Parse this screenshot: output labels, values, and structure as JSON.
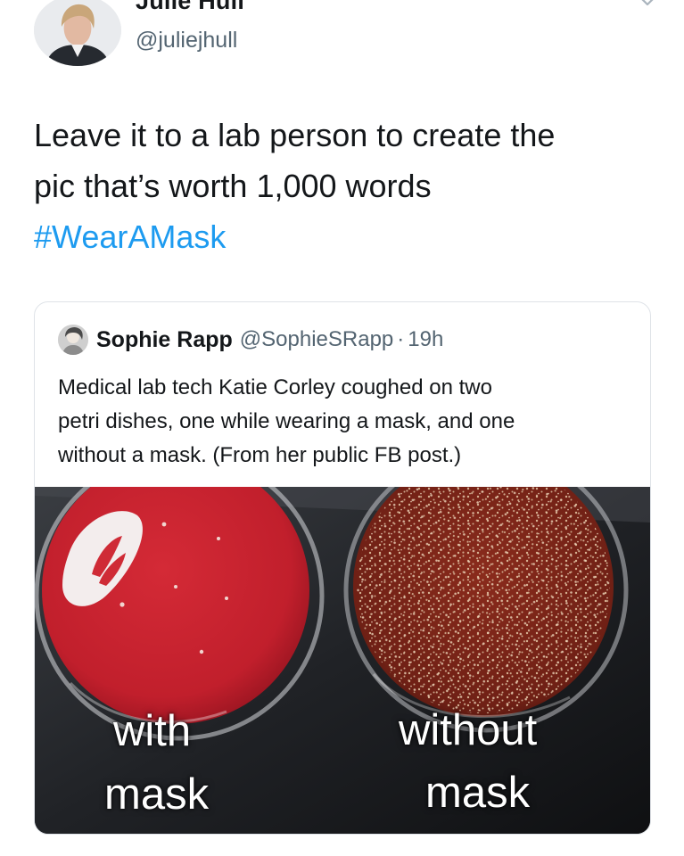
{
  "author": {
    "name": "Julie Hull",
    "handle": "@juliejhull",
    "avatar_icon": "profile-photo-icon",
    "menu_icon": "chevron-down-icon"
  },
  "tweet": {
    "lines": [
      "Leave it to a lab person to create the",
      "pic that’s worth 1,000 words"
    ],
    "hashtag": "#WearAMask"
  },
  "quoted": {
    "name": "Sophie Rapp",
    "handle": "@SophieSRapp",
    "separator": "·",
    "time": "19h",
    "avatar_icon": "profile-photo-icon",
    "lines": [
      "Medical lab tech Katie Corley coughed on two",
      "petri dishes, one while wearing a mask, and one",
      "without a mask. (From her public FB post.)"
    ],
    "media": {
      "left_caption": [
        "with",
        "mask"
      ],
      "right_caption": [
        "without",
        "mask"
      ]
    }
  },
  "colors": {
    "text": "#14171a",
    "secondary": "#536471",
    "link": "#1d9bf0",
    "border": "#dfe3e8",
    "agar_clean": "#c4242f",
    "agar_contaminated": "#7a2418"
  }
}
